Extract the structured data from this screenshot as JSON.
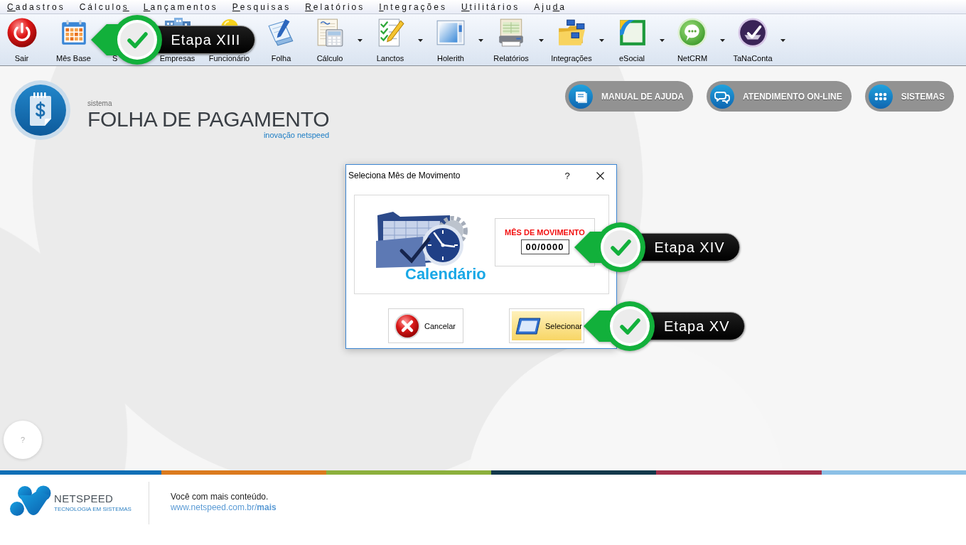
{
  "menu": [
    {
      "hotkey": "C",
      "after": "adastros"
    },
    {
      "before": "Cálculo",
      "hotkey": "s"
    },
    {
      "hotkey": "L",
      "after": "ançamentos"
    },
    {
      "hotkey": "P",
      "after": "esquisas"
    },
    {
      "hotkey": "R",
      "after": "elatórios"
    },
    {
      "hotkey": "I",
      "after": "ntegrações"
    },
    {
      "hotkey": "U",
      "after": "tilitários"
    },
    {
      "before": "Aju",
      "hotkey": "d",
      "after": "a"
    }
  ],
  "toolbar": [
    {
      "label": "Sair",
      "dropdown": false
    },
    {
      "label": "Mês Base",
      "dropdown": false,
      "callout": "Etapa XIII"
    },
    {
      "label": "S",
      "dropdown": false
    },
    {
      "label": "Empresas",
      "dropdown": false
    },
    {
      "label": "Funcionário",
      "dropdown": false
    },
    {
      "label": "Folha",
      "dropdown": false
    },
    {
      "label": "Cálculo",
      "dropdown": true
    },
    {
      "label": "Lanctos",
      "dropdown": true
    },
    {
      "label": "Holerith",
      "dropdown": true
    },
    {
      "label": "Relatórios",
      "dropdown": true
    },
    {
      "label": "Integrações",
      "dropdown": true
    },
    {
      "label": "eSocial",
      "dropdown": true
    },
    {
      "label": "NetCRM",
      "dropdown": true
    },
    {
      "label": "TaNaConta",
      "dropdown": true
    }
  ],
  "brand": {
    "subtitle": "sistema",
    "title": "FOLHA DE PAGAMENTO",
    "tagline": "inovação netspeed"
  },
  "header_buttons": [
    {
      "label": "MANUAL DE AJUDA"
    },
    {
      "label": "ATENDIMENTO ON-LINE"
    },
    {
      "label": "SISTEMAS"
    }
  ],
  "dialog": {
    "title": "Seleciona Mês de Movimento",
    "help_label": "?",
    "image_caption": "Calendário",
    "field": {
      "label": "MÊS DE MOVIMENTO",
      "value": "00/0000",
      "callout": "Etapa XIV"
    },
    "buttons": [
      {
        "label": "Cancelar",
        "highlighted": false
      },
      {
        "label": "Selecionar",
        "highlighted": true,
        "callout": "Etapa XV"
      }
    ]
  },
  "help_bubble": {
    "label": "?"
  },
  "footer": {
    "logo_name": "NETSPEED",
    "logo_tagline": "TECNOLOGIA EM SISTEMAS",
    "message": "Você com mais conteúdo.",
    "link": "www.netspeed.com.br/**mais**"
  }
}
